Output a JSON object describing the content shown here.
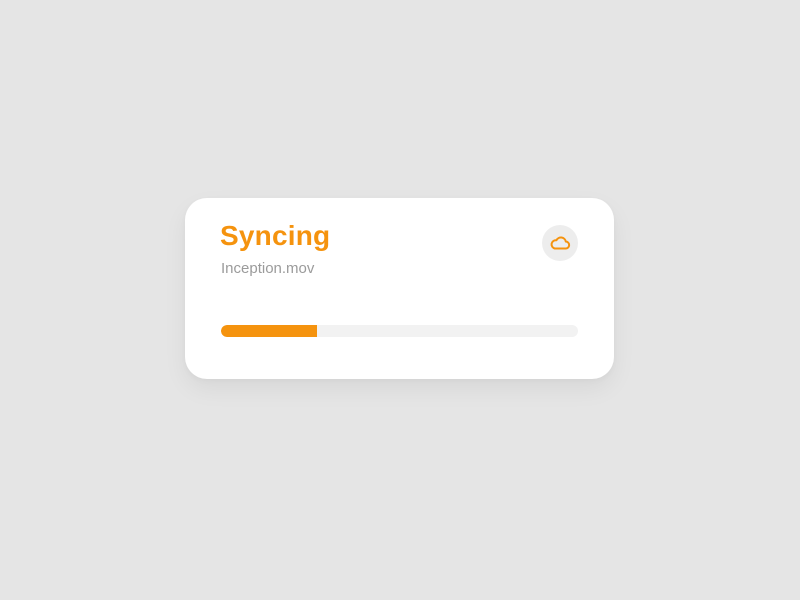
{
  "sync_card": {
    "title": "Syncing",
    "filename": "Inception.mov",
    "progress_fraction": 0.27,
    "icon": "cloud-icon"
  },
  "colors": {
    "accent": "#f5930e",
    "background": "#e5e5e5",
    "card": "#ffffff",
    "muted_text": "#9b9b9b",
    "track": "#f2f2f2",
    "icon_bg": "#ededed"
  }
}
